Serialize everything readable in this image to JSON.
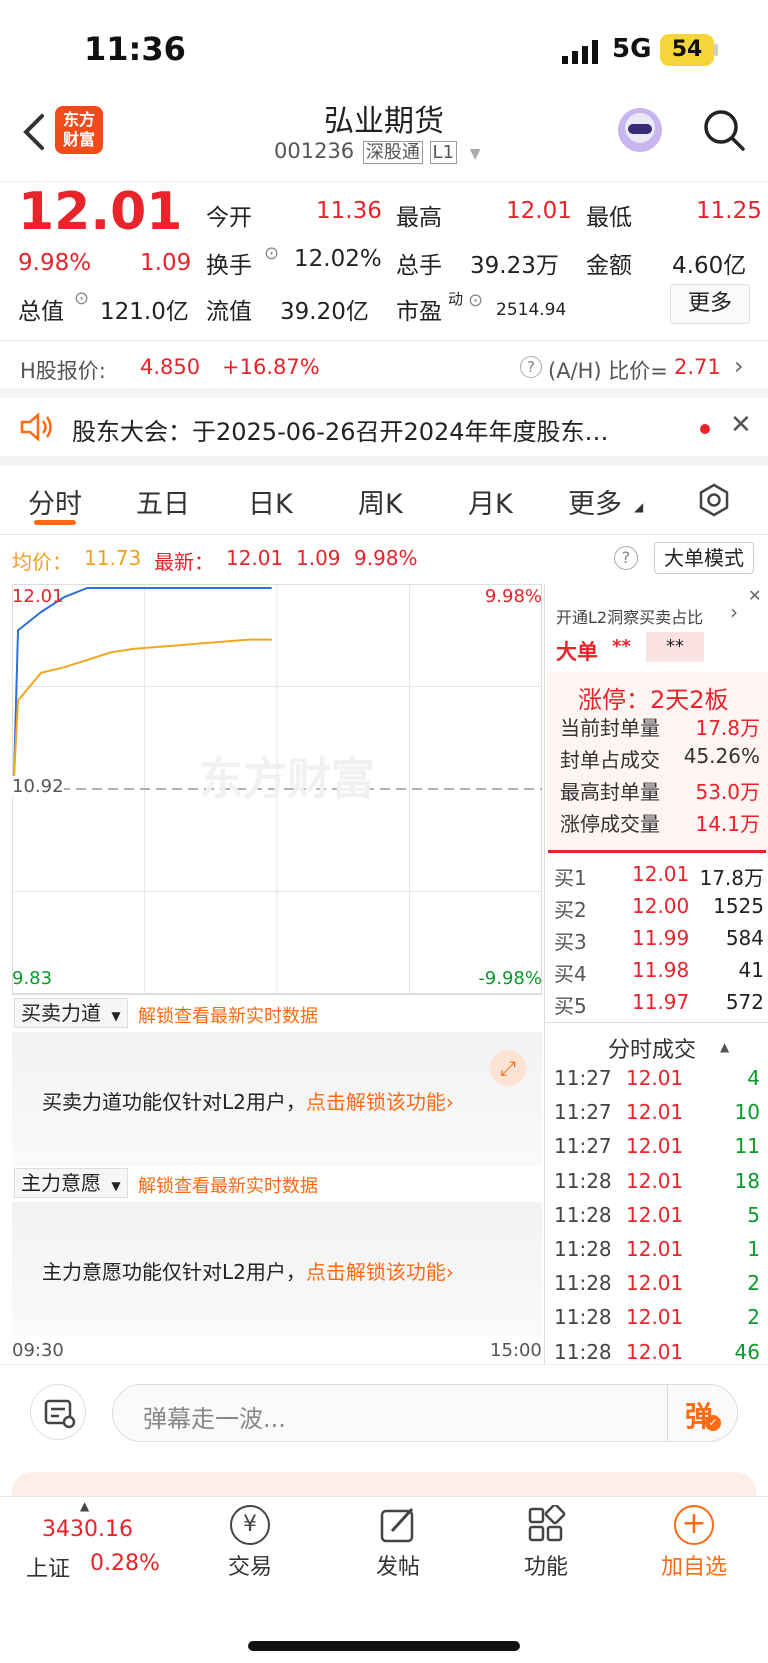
{
  "status_bar": {
    "time": "11:36",
    "network": "5G",
    "battery": "54"
  },
  "header": {
    "title": "弘业期货",
    "code": "001236",
    "market_tag": "深股通",
    "level_tag": "L1",
    "logo_text_line1": "东方",
    "logo_text_line2": "财富"
  },
  "quote": {
    "price": "12.01",
    "pct": "9.98%",
    "change": "1.09",
    "open_label": "今开",
    "open": "11.36",
    "high_label": "最高",
    "high": "12.01",
    "low_label": "最低",
    "low": "11.25",
    "turnover_label": "换手",
    "turnover": "12.02%",
    "volume_label": "总手",
    "volume": "39.23万",
    "amount_label": "金额",
    "amount": "4.60亿",
    "mktcap_label": "总值",
    "mktcap": "121.0亿",
    "float_label": "流值",
    "float": "39.20亿",
    "pe_label": "市盈",
    "pe_sup": "动",
    "pe": "2514.94",
    "more_button": "更多"
  },
  "hshare": {
    "label": "H股报价:",
    "price": "4.850",
    "pct": "+16.87%",
    "ratio_label": "(A/H) 比价=",
    "ratio": "2.71"
  },
  "notice": {
    "text": "股东大会：于2025-06-26召开2024年年度股东…"
  },
  "tabs": [
    "分时",
    "五日",
    "日K",
    "周K",
    "月K",
    "更多"
  ],
  "chart_info": {
    "avg_label": "均价：",
    "avg": "11.73",
    "latest_label": "最新：",
    "latest": "12.01",
    "change": "1.09",
    "pct": "9.98%",
    "mode_button": "大单模式"
  },
  "chart_data": {
    "type": "line",
    "x_start_label": "09:30",
    "x_end_label": "15:00",
    "y_top": "12.01",
    "y_mid": "10.92",
    "y_bottom": "9.83",
    "pct_top": "9.98%",
    "pct_bottom": "-9.98%",
    "ylim": [
      9.83,
      12.01
    ],
    "series": [
      {
        "values": [
          10.98,
          11.78,
          11.88,
          11.96,
          12.01,
          12.01,
          12.01,
          12.01,
          12.01,
          12.01,
          12.01,
          12.01,
          12.01
        ]
      },
      {
        "values": [
          10.98,
          11.4,
          11.55,
          11.58,
          11.62,
          11.66,
          11.68,
          11.69,
          11.7,
          11.71,
          11.72,
          11.73,
          11.73
        ]
      }
    ],
    "session_fraction": 0.49,
    "watermark": "东方财富"
  },
  "panels": [
    {
      "title": "买卖力道",
      "unlock_link": "解锁查看最新实时数据",
      "message": "买卖力道功能仅针对L2用户，",
      "action": "点击解锁该功能"
    },
    {
      "title": "主力意愿",
      "unlock_link": "解锁查看最新实时数据",
      "message": "主力意愿功能仅针对L2用户，",
      "action": "点击解锁该功能"
    }
  ],
  "right_panel": {
    "l2_promo": "开通L2洞察买卖占比",
    "big_order_label": "大单",
    "big_order_val1": "**",
    "big_order_val2": "**",
    "limit_up": "涨停：2天2板",
    "stats": [
      {
        "label": "当前封单量",
        "value": "17.8万"
      },
      {
        "label": "封单占成交",
        "value": "45.26%"
      },
      {
        "label": "最高封单量",
        "value": "53.0万"
      },
      {
        "label": "涨停成交量",
        "value": "14.1万"
      }
    ],
    "order_book": [
      {
        "label": "买1",
        "price": "12.01",
        "vol": "17.8万"
      },
      {
        "label": "买2",
        "price": "12.00",
        "vol": "1525"
      },
      {
        "label": "买3",
        "price": "11.99",
        "vol": "584"
      },
      {
        "label": "买4",
        "price": "11.98",
        "vol": "41"
      },
      {
        "label": "买5",
        "price": "11.97",
        "vol": "572"
      }
    ],
    "trades_title": "分时成交",
    "trades": [
      {
        "time": "11:27",
        "price": "12.01",
        "vol": "4"
      },
      {
        "time": "11:27",
        "price": "12.01",
        "vol": "10"
      },
      {
        "time": "11:27",
        "price": "12.01",
        "vol": "11"
      },
      {
        "time": "11:28",
        "price": "12.01",
        "vol": "18"
      },
      {
        "time": "11:28",
        "price": "12.01",
        "vol": "5"
      },
      {
        "time": "11:28",
        "price": "12.01",
        "vol": "1"
      },
      {
        "time": "11:28",
        "price": "12.01",
        "vol": "2"
      },
      {
        "time": "11:28",
        "price": "12.01",
        "vol": "2"
      },
      {
        "time": "11:28",
        "price": "12.01",
        "vol": "46"
      }
    ]
  },
  "comment_bar": {
    "placeholder": "弹幕走一波...",
    "send_label": "弹"
  },
  "bottom_nav": {
    "index_value": "3430.16",
    "index_name": "上证",
    "index_pct": "0.28%",
    "items": [
      "交易",
      "发帖",
      "功能",
      "加自选"
    ]
  }
}
